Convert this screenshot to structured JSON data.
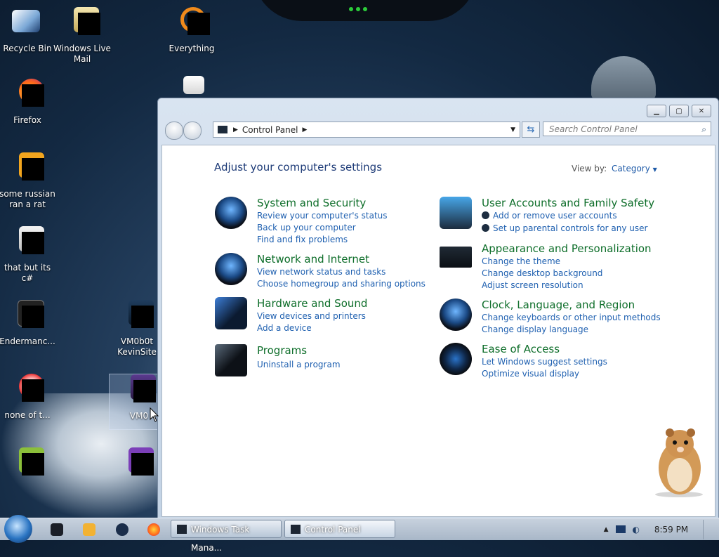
{
  "desktop": {
    "icons": [
      {
        "label": "Recycle Bin"
      },
      {
        "label": "Windows Live Mail"
      },
      {
        "label": "Everything"
      },
      {
        "label": "Firefox"
      },
      {
        "label": "some russian ran a rat"
      },
      {
        "label": "that but its c#"
      },
      {
        "label": "Endermanc..."
      },
      {
        "label": "VM0b0t KevinSite"
      },
      {
        "label": "none of t..."
      },
      {
        "label": "VM0"
      }
    ]
  },
  "window": {
    "address": {
      "path": "Control Panel"
    },
    "search": {
      "placeholder": "Search Control Panel"
    },
    "heading": "Adjust your computer's settings",
    "view_by": {
      "label": "View by:",
      "value": "Category"
    },
    "categories": [
      {
        "title": "System and Security",
        "links": [
          "Review your computer's status",
          "Back up your computer",
          "Find and fix problems"
        ]
      },
      {
        "title": "Network and Internet",
        "links": [
          "View network status and tasks",
          "Choose homegroup and sharing options"
        ]
      },
      {
        "title": "Hardware and Sound",
        "links": [
          "View devices and printers",
          "Add a device"
        ]
      },
      {
        "title": "Programs",
        "links": [
          "Uninstall a program"
        ]
      },
      {
        "title": "User Accounts and Family Safety",
        "links": [
          "Add or remove user accounts",
          "Set up parental controls for any user"
        ]
      },
      {
        "title": "Appearance and Personalization",
        "links": [
          "Change the theme",
          "Change desktop background",
          "Adjust screen resolution"
        ]
      },
      {
        "title": "Clock, Language, and Region",
        "links": [
          "Change keyboards or other input methods",
          "Change display language"
        ]
      },
      {
        "title": "Ease of Access",
        "links": [
          "Let Windows suggest settings",
          "Optimize visual display"
        ]
      }
    ]
  },
  "taskbar": {
    "tasks": [
      {
        "label": "Windows Task Mana..."
      },
      {
        "label": "Control Panel"
      }
    ],
    "clock": "8:59 PM"
  }
}
